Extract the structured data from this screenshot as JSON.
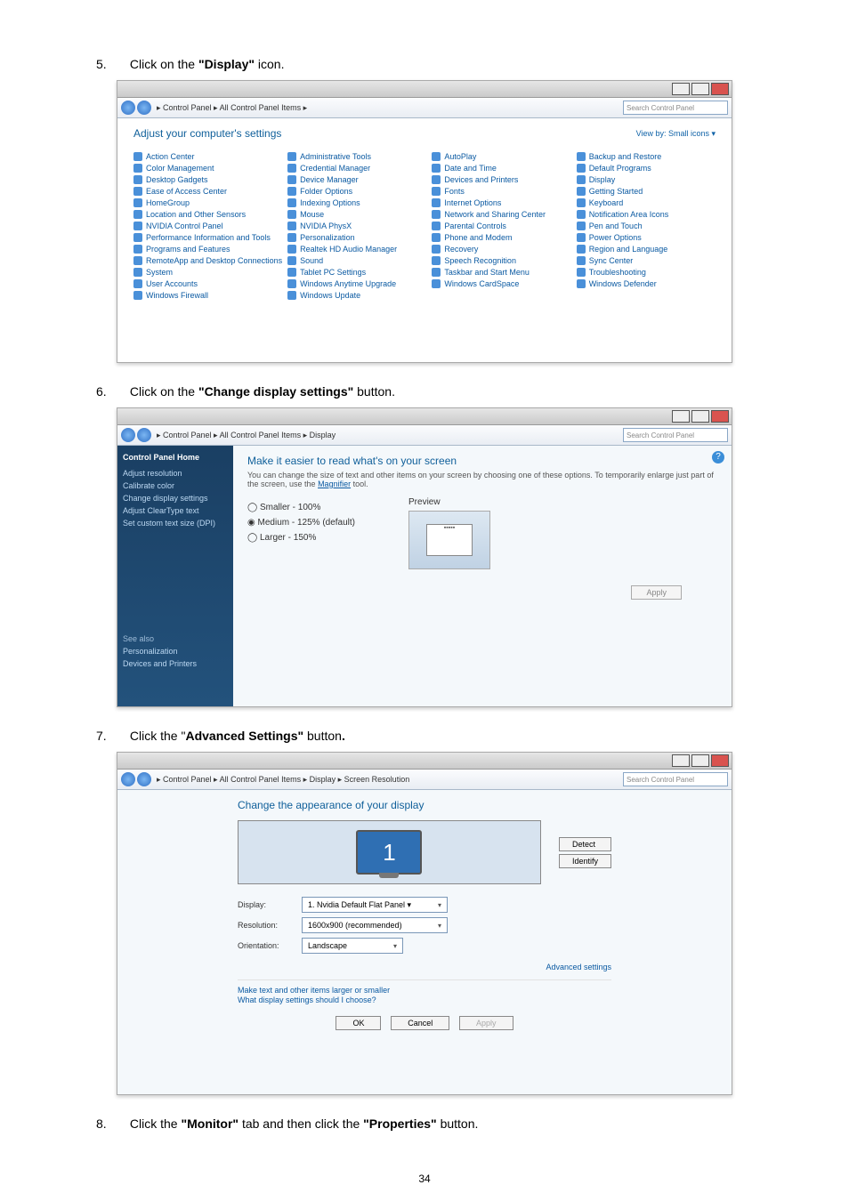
{
  "pageNumber": "34",
  "steps": {
    "s5": {
      "num": "5.",
      "text_a": "Click on the ",
      "bold": "\"Display\"",
      "text_b": " icon."
    },
    "s6": {
      "num": "6.",
      "text_a": "Click on the ",
      "bold": "\"Change display settings\"",
      "text_b": " button."
    },
    "s7": {
      "num": "7.",
      "text_a": "Click the ",
      "quote": "\"",
      "bold": "Advanced Settings\"",
      "text_b": " button",
      "period": "."
    },
    "s8": {
      "num": "8.",
      "text_a": "Click the ",
      "bold1": "\"Monitor\"",
      "text_b": " tab and then click the ",
      "bold2": "\"Properties\"",
      "text_c": " button."
    }
  },
  "shot1": {
    "breadcrumb": "▸ Control Panel ▸ All Control Panel Items ▸",
    "search_placeholder": "Search Control Panel",
    "heading": "Adjust your computer's settings",
    "viewby": "View by:  Small icons ▾",
    "items": [
      "Action Center",
      "Administrative Tools",
      "AutoPlay",
      "Backup and Restore",
      "Color Management",
      "Credential Manager",
      "Date and Time",
      "Default Programs",
      "Desktop Gadgets",
      "Device Manager",
      "Devices and Printers",
      "Display",
      "Ease of Access Center",
      "Folder Options",
      "Fonts",
      "Getting Started",
      "HomeGroup",
      "Indexing Options",
      "Internet Options",
      "Keyboard",
      "Location and Other Sensors",
      "Mouse",
      "Network and Sharing Center",
      "Notification Area Icons",
      "NVIDIA Control Panel",
      "NVIDIA PhysX",
      "Parental Controls",
      "Pen and Touch",
      "Performance Information and Tools",
      "Personalization",
      "Phone and Modem",
      "Power Options",
      "Programs and Features",
      "Realtek HD Audio Manager",
      "Recovery",
      "Region and Language",
      "RemoteApp and Desktop Connections",
      "Sound",
      "Speech Recognition",
      "Sync Center",
      "System",
      "Tablet PC Settings",
      "Taskbar and Start Menu",
      "Troubleshooting",
      "User Accounts",
      "Windows Anytime Upgrade",
      "Windows CardSpace",
      "Windows Defender",
      "Windows Firewall",
      "Windows Update"
    ]
  },
  "shot2": {
    "breadcrumb": "▸ Control Panel ▸ All Control Panel Items ▸ Display",
    "search_placeholder": "Search Control Panel",
    "sidebar": {
      "home": "Control Panel Home",
      "links": [
        "Adjust resolution",
        "Calibrate color",
        "Change display settings",
        "Adjust ClearType text",
        "Set custom text size (DPI)"
      ],
      "seealso_h": "See also",
      "seealso": [
        "Personalization",
        "Devices and Printers"
      ]
    },
    "heading": "Make it easier to read what's on your screen",
    "sub_a": "You can change the size of text and other items on your screen by choosing one of these options. To temporarily enlarge just part of the screen, use the ",
    "sub_link": "Magnifier",
    "sub_b": " tool.",
    "opt_small": "Smaller - 100%",
    "opt_med": "Medium - 125% (default)",
    "opt_large": "Larger - 150%",
    "preview_label": "Preview",
    "apply": "Apply"
  },
  "shot3": {
    "breadcrumb": "▸ Control Panel ▸ All Control Panel Items ▸ Display ▸ Screen Resolution",
    "search_placeholder": "Search Control Panel",
    "heading": "Change the appearance of your display",
    "monitor_num": "1",
    "detect": "Detect",
    "identify": "Identify",
    "rows": {
      "display_l": "Display:",
      "display_v": "1. Nvidia Default Flat Panel  ▾",
      "res_l": "Resolution:",
      "res_v": "1600x900 (recommended)",
      "orient_l": "Orientation:",
      "orient_v": "Landscape"
    },
    "adv_link": "Advanced settings",
    "link1": "Make text and other items larger or smaller",
    "link2": "What display settings should I choose?",
    "ok": "OK",
    "cancel": "Cancel",
    "apply": "Apply"
  }
}
